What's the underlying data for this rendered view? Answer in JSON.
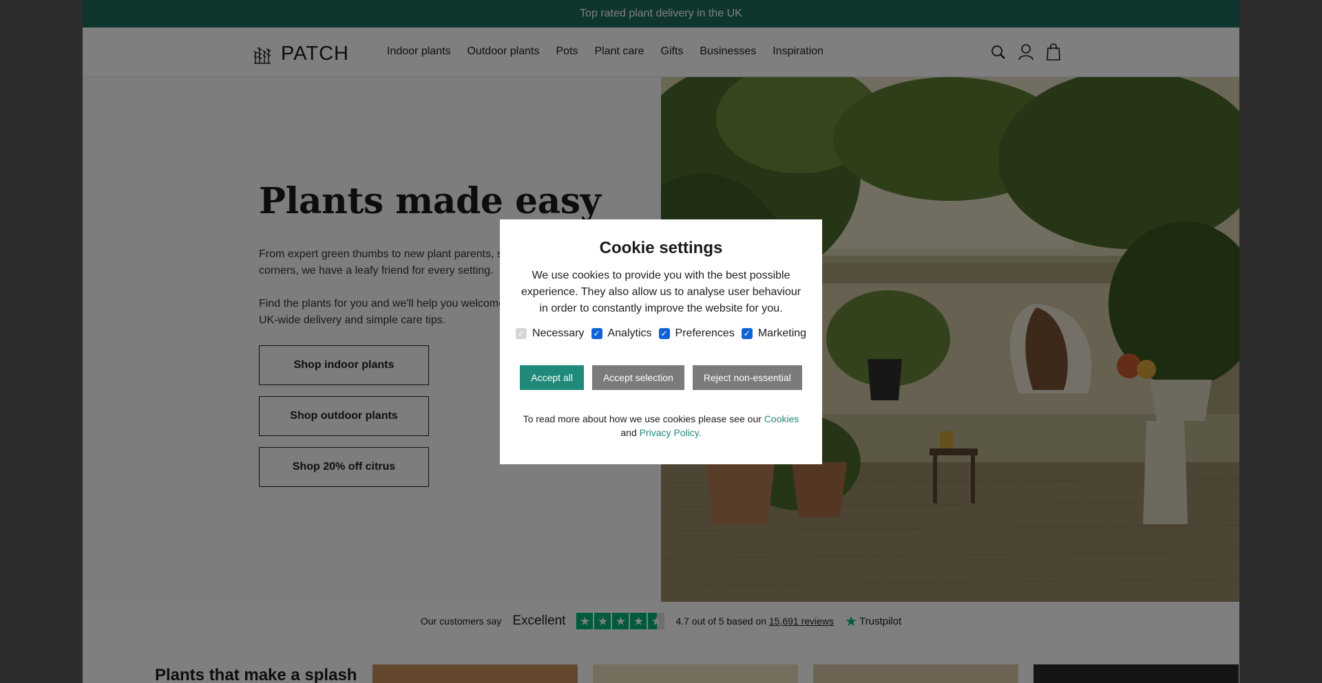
{
  "announcement": "Top rated plant delivery in the UK",
  "brand": {
    "name": "PATCH"
  },
  "nav": [
    {
      "label": "Indoor plants"
    },
    {
      "label": "Outdoor plants"
    },
    {
      "label": "Pots"
    },
    {
      "label": "Plant care"
    },
    {
      "label": "Gifts"
    },
    {
      "label": "Businesses"
    },
    {
      "label": "Inspiration"
    }
  ],
  "header_icons": [
    "search-icon",
    "account-icon",
    "bag-icon"
  ],
  "hero": {
    "title": "Plants made easy",
    "paragraph1": "From expert green thumbs to new plant parents, sunny spots to shady corners, we have a leafy friend for every setting.",
    "paragraph2": "Find the plants for you and we'll help you welcome them home with UK-wide delivery and simple care tips.",
    "buttons": [
      "Shop indoor plants",
      "Shop outdoor plants",
      "Shop 20% off citrus"
    ]
  },
  "trustpilot": {
    "prefix": "Our customers say",
    "rating_word": "Excellent",
    "rating_value": 4.7,
    "score_text_pre": "4.7 out of 5 based on",
    "reviews_link": "15,691 reviews",
    "brand": "Trustpilot"
  },
  "section": {
    "title": "Plants that make a splash"
  },
  "cookie": {
    "title": "Cookie settings",
    "text": "We use cookies to provide you with the best possible experience. They also allow us to analyse user behaviour in order to constantly improve the website for you.",
    "options": [
      {
        "label": "Necessary",
        "checked": true,
        "disabled": true
      },
      {
        "label": "Analytics",
        "checked": true,
        "disabled": false
      },
      {
        "label": "Preferences",
        "checked": true,
        "disabled": false
      },
      {
        "label": "Marketing",
        "checked": true,
        "disabled": false
      }
    ],
    "accept_all": "Accept all",
    "accept_selection": "Accept selection",
    "reject": "Reject non-essential",
    "footer_pre": "To read more about how we use cookies please see our",
    "cookies_link": "Cookies",
    "footer_and": "and",
    "privacy_link": "Privacy Policy."
  },
  "colors": {
    "brand_green": "#1f6b5e",
    "accent_teal": "#1f8a7a",
    "button_grey": "#7b7b7b",
    "trustpilot_green": "#00b67a"
  }
}
